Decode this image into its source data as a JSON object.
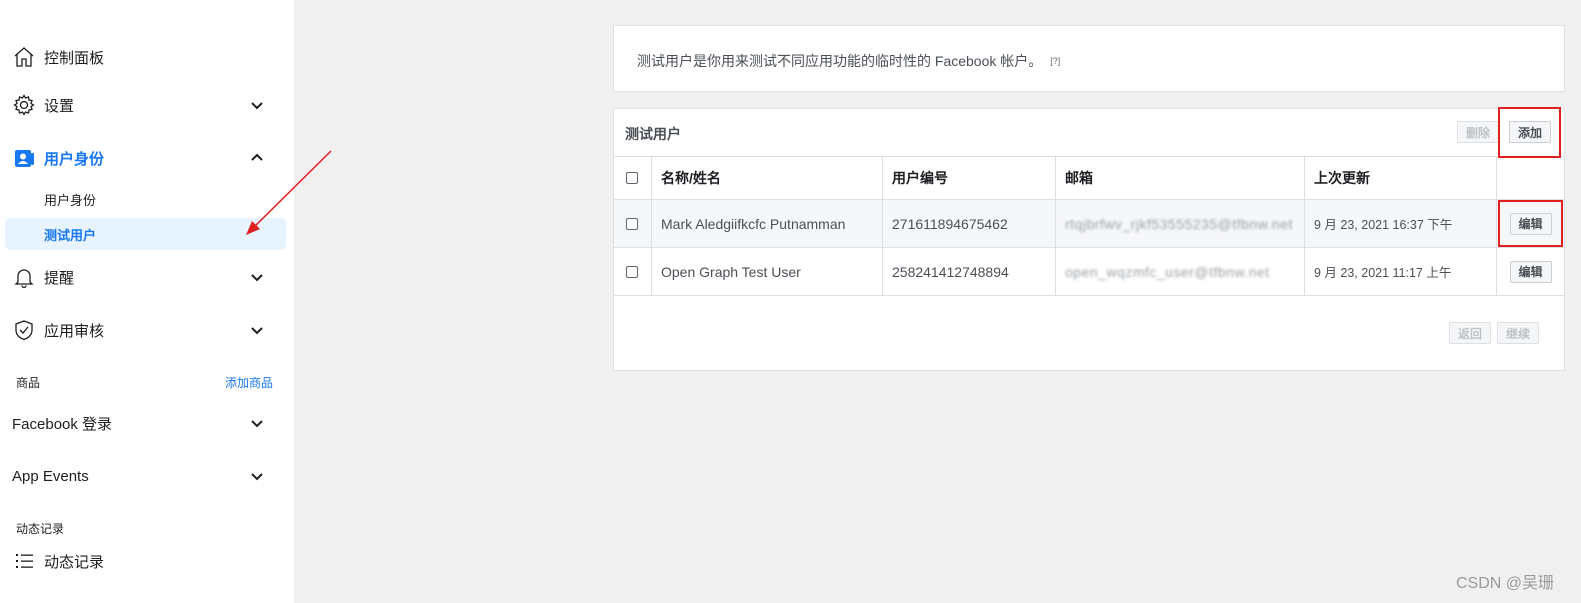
{
  "sidebar": {
    "dashboard": "控制面板",
    "settings": "设置",
    "roles": "用户身份",
    "roles_sub": "用户身份",
    "test_users": "测试用户",
    "alerts": "提醒",
    "app_review": "应用审核",
    "products_label": "商品",
    "add_product": "添加商品",
    "facebook_login": "Facebook 登录",
    "app_events": "App Events",
    "activity_label": "动态记录",
    "activity_log": "动态记录"
  },
  "info": {
    "text": "测试用户是你用来测试不同应用功能的临时性的 Facebook 帐户。",
    "help": "[?]"
  },
  "panel": {
    "title": "测试用户",
    "delete_label": "删除",
    "add_label": "添加",
    "back_label": "返回",
    "continue_label": "继续"
  },
  "table": {
    "headers": [
      "名称/姓名",
      "用户编号",
      "邮箱",
      "上次更新"
    ],
    "rows": [
      {
        "name": "Mark Aledgiifkcfc Putnamman",
        "id": "271611894675462",
        "email": "rtqjbrfwv_rjkf53555235@tfbnw.net",
        "updated": "9 月 23, 2021 16:37 下午",
        "edit": "编辑"
      },
      {
        "name": "Open Graph Test User",
        "id": "258241412748894",
        "email": "open_wqzmfc_user@tfbnw.net",
        "updated": "9 月 23, 2021 11:17 上午",
        "edit": "编辑"
      }
    ]
  },
  "watermark": "CSDN @吴珊",
  "colors": {
    "accent": "#1877f2",
    "highlight": "#e02020"
  }
}
